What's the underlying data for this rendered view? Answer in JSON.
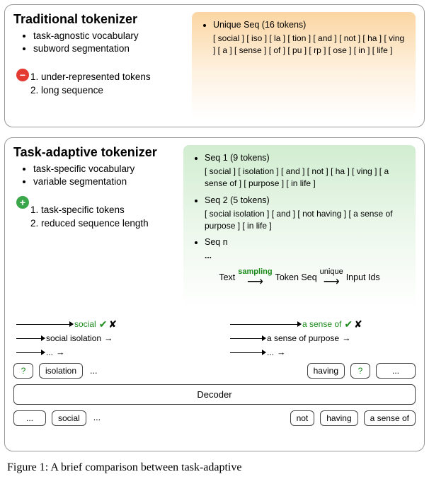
{
  "traditional": {
    "title": "Traditional tokenizer",
    "props": [
      "task-agnostic vocabulary",
      "subword segmentation"
    ],
    "cons": [
      "1. under-represented tokens",
      "2. long sequence"
    ],
    "seq_title": "Unique Seq (16 tokens)",
    "tokens": "[ social ] [ iso ] [ la ] [ tion ] [ and ] [ not ] [ ha ] [ ving ] [ a ] [ sense ] [ of ] [ pu ] [ rp ] [ ose ] [ in ] [ life ]"
  },
  "adaptive": {
    "title": "Task-adaptive tokenizer",
    "props": [
      "task-specific vocabulary",
      "variable segmentation"
    ],
    "pros": [
      "1. task-specific tokens",
      "2. reduced sequence length"
    ],
    "seq1_title": "Seq 1 (9 tokens)",
    "seq1_tokens": "[ social ] [ isolation ] [ and ] [ not ] [ ha ] [ ving ] [ a sense of ] [ purpose ] [ in life ]",
    "seq2_title": "Seq 2 (5 tokens)",
    "seq2_tokens": "[ social isolation ] [ and ] [ not having ] [ a sense of purpose ] [ in life ]",
    "seqn_title": "Seq n",
    "seqn_tokens": "...",
    "flow_text": "Text",
    "flow_sampling": "sampling",
    "flow_tokenseq": "Token Seq",
    "flow_unique": "unique",
    "flow_input": "Input Ids"
  },
  "diagram": {
    "left_candidates": {
      "a": "social",
      "b": "social isolation",
      "c": "..."
    },
    "right_candidates": {
      "a": "a sense of",
      "b": "a sense of purpose",
      "c": "..."
    },
    "slots": {
      "r1c1": "?",
      "r1c2": "isolation",
      "r1c3": "...",
      "r1c4": "having",
      "r1c5": "?",
      "r1c6": "...",
      "decoder": "Decoder",
      "r3c1": "...",
      "r3c2": "social",
      "r3c3": "...",
      "r3c4": "not",
      "r3c5": "having",
      "r3c6": "a sense of"
    }
  },
  "caption": "Figure 1:  A brief comparison between task-adaptive"
}
